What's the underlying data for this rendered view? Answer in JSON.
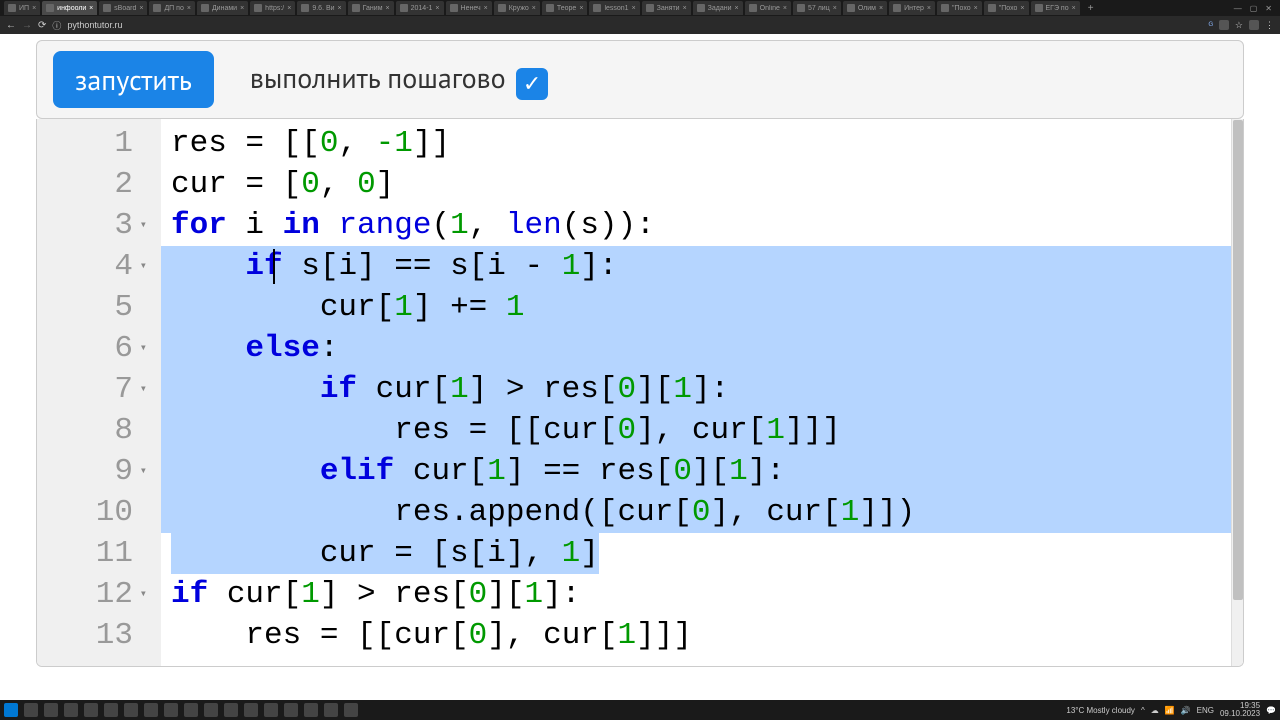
{
  "browser": {
    "tabs": [
      "ИП",
      "инфоолимп",
      "sBoard",
      "ДП по",
      "Динами",
      "https:/",
      "9.6. Ви",
      "Ганим",
      "2014-1",
      "Ненеч",
      "Кружо",
      "Теоре",
      "lesson1",
      "Заняти",
      "Задани",
      "Online",
      "57 лиц",
      "Олим",
      "Интер",
      "\"Похо",
      "\"Похо",
      "ЕГЭ по"
    ],
    "active_tab_index": 1,
    "url": "pythontutor.ru",
    "add_tab": "+"
  },
  "toolbar": {
    "run_label": "запустить",
    "step_label": "выполнить пошагово"
  },
  "editor": {
    "gutter": [
      {
        "n": "1",
        "fold": ""
      },
      {
        "n": "2",
        "fold": ""
      },
      {
        "n": "3",
        "fold": "▾"
      },
      {
        "n": "4",
        "fold": "▾"
      },
      {
        "n": "5",
        "fold": ""
      },
      {
        "n": "6",
        "fold": "▾"
      },
      {
        "n": "7",
        "fold": "▾"
      },
      {
        "n": "8",
        "fold": ""
      },
      {
        "n": "9",
        "fold": "▾"
      },
      {
        "n": "10",
        "fold": ""
      },
      {
        "n": "11",
        "fold": ""
      },
      {
        "n": "12",
        "fold": "▾"
      },
      {
        "n": "13",
        "fold": ""
      }
    ],
    "code": {
      "l1": {
        "a": "res = [[",
        "b": "0",
        ",": ", ",
        "c": "-1",
        "d": "]]"
      },
      "l2": {
        "a": "cur = [",
        "b": "0",
        ",": ", ",
        "c": "0",
        "d": "]"
      },
      "l3": {
        "for": "for",
        "sp1": " i ",
        "in": "in",
        "sp2": " ",
        "range": "range",
        "a": "(",
        "one": "1",
        "b": ", ",
        "len": "len",
        "c": "(s)):"
      },
      "l4": {
        "indent": "    ",
        "if": "if",
        "a": " s[i] == s[i - ",
        "one": "1",
        "b": "]:"
      },
      "l5": {
        "indent": "        ",
        "a": "cur[",
        "one1": "1",
        "b": "] += ",
        "one2": "1"
      },
      "l6": {
        "indent": "    ",
        "else": "else",
        "colon": ":"
      },
      "l7": {
        "indent": "        ",
        "if": "if",
        "a": " cur[",
        "one1": "1",
        "b": "] > res[",
        "zero": "0",
        "c": "][",
        "one2": "1",
        "d": "]:"
      },
      "l8": {
        "indent": "            ",
        "a": "res = [[cur[",
        "zero": "0",
        "b": "], cur[",
        "one": "1",
        "c": "]]]"
      },
      "l9": {
        "indent": "        ",
        "elif": "elif",
        "a": " cur[",
        "one1": "1",
        "b": "] == res[",
        "zero": "0",
        "c": "][",
        "one2": "1",
        "d": "]:"
      },
      "l10": {
        "indent": "            ",
        "a": "res.append([cur[",
        "zero": "0",
        "b": "], cur[",
        "one": "1",
        "c": "]])"
      },
      "l11": {
        "indent": "        ",
        "a": "cur = [s[i], ",
        "one": "1",
        "b": "]"
      },
      "l12": {
        "if": "if",
        "a": " cur[",
        "one1": "1",
        "b": "] > res[",
        "zero": "0",
        "c": "][",
        "one2": "1",
        "d": "]:"
      },
      "l13": {
        "indent": "    ",
        "a": "res = [[cur[",
        "zero": "0",
        "b": "], cur[",
        "one": "1",
        "c": "]]]"
      }
    }
  },
  "tray": {
    "weather": "13°C Mostly cloudy",
    "lang": "ENG",
    "time": "19:35",
    "date": "09.10.2023"
  }
}
